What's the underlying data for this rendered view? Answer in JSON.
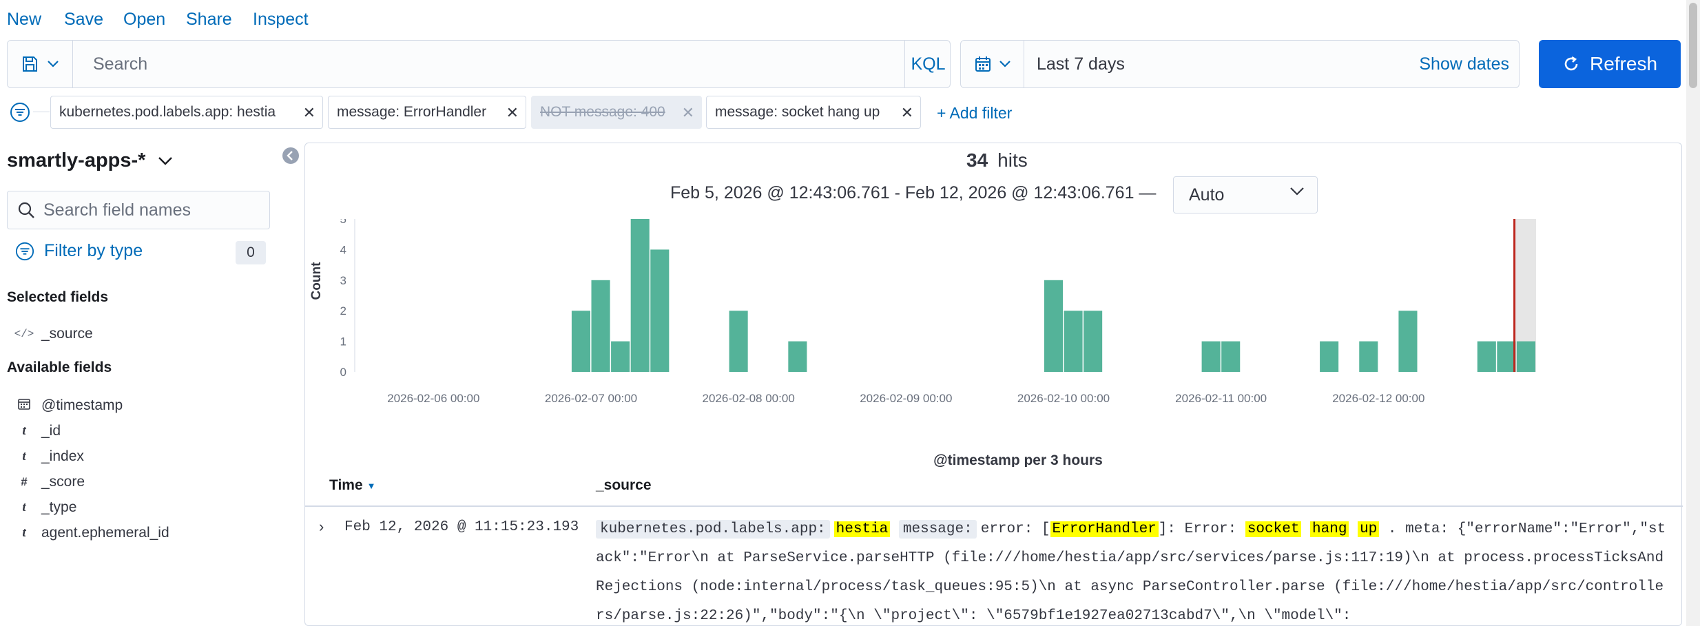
{
  "menu": [
    "New",
    "Save",
    "Open",
    "Share",
    "Inspect"
  ],
  "query": {
    "placeholder": "Search",
    "language": "KQL"
  },
  "date": {
    "range": "Last 7 days",
    "show_dates": "Show dates"
  },
  "refresh_label": "Refresh",
  "filters": [
    {
      "label": "kubernetes.pod.labels.app: hestia",
      "disabled": false
    },
    {
      "label": "message: ErrorHandler",
      "disabled": false
    },
    {
      "label": "NOT message: 400",
      "disabled": true
    },
    {
      "label": "message: socket hang up",
      "disabled": false
    }
  ],
  "add_filter": "+ Add filter",
  "sidebar": {
    "index_pattern": "smartly-apps-*",
    "search_placeholder": "Search field names",
    "filter_by_type": "Filter by type",
    "type_count": "0",
    "selected_title": "Selected fields",
    "selected_fields": [
      {
        "type": "</>",
        "name": "_source"
      }
    ],
    "available_title": "Available fields",
    "available_fields": [
      {
        "type": "calendar",
        "name": "@timestamp"
      },
      {
        "type": "t",
        "name": "_id"
      },
      {
        "type": "t",
        "name": "_index"
      },
      {
        "type": "#",
        "name": "_score"
      },
      {
        "type": "t",
        "name": "_type"
      },
      {
        "type": "t",
        "name": "agent.ephemeral_id"
      }
    ]
  },
  "hits": {
    "count": "34",
    "label": "hits"
  },
  "time_range_line": "Feb 5, 2026 @ 12:43:06.761 - Feb 12, 2026 @ 12:43:06.761 —",
  "interval": "Auto",
  "chart_data": {
    "type": "bar",
    "ylabel": "Count",
    "xlabel": "@timestamp per 3 hours",
    "ylim": [
      0,
      5
    ],
    "yticks": [
      0,
      1,
      2,
      3,
      4,
      5
    ],
    "bar_color": "#54b399",
    "x_start": "2026-02-05 12:00",
    "bucket_hours": 3,
    "x_ticks": [
      {
        "label": "2026-02-06 00:00",
        "hours": 12
      },
      {
        "label": "2026-02-07 00:00",
        "hours": 36
      },
      {
        "label": "2026-02-08 00:00",
        "hours": 60
      },
      {
        "label": "2026-02-09 00:00",
        "hours": 84
      },
      {
        "label": "2026-02-10 00:00",
        "hours": 108
      },
      {
        "label": "2026-02-11 00:00",
        "hours": 132
      },
      {
        "label": "2026-02-12 00:00",
        "hours": 156
      }
    ],
    "bars": [
      {
        "hours": 33,
        "value": 2
      },
      {
        "hours": 36,
        "value": 3
      },
      {
        "hours": 39,
        "value": 1
      },
      {
        "hours": 42,
        "value": 5
      },
      {
        "hours": 45,
        "value": 4
      },
      {
        "hours": 57,
        "value": 2
      },
      {
        "hours": 66,
        "value": 1
      },
      {
        "hours": 105,
        "value": 3
      },
      {
        "hours": 108,
        "value": 2
      },
      {
        "hours": 111,
        "value": 2
      },
      {
        "hours": 129,
        "value": 1
      },
      {
        "hours": 132,
        "value": 1
      },
      {
        "hours": 147,
        "value": 1
      },
      {
        "hours": 153,
        "value": 1
      },
      {
        "hours": 159,
        "value": 2
      },
      {
        "hours": 171,
        "value": 1
      },
      {
        "hours": 174,
        "value": 1
      },
      {
        "hours": 177,
        "value": 1
      }
    ],
    "now_marker_hours": 176.7,
    "x_end_hours": 180
  },
  "table": {
    "time_header": "Time",
    "source_header": "_source"
  },
  "document": {
    "time": "Feb 12, 2026 @ 11:15:23.193",
    "key1": "kubernetes.pod.labels.app:",
    "val1": "hestia",
    "key2": "message:",
    "msg_a": "error: [",
    "hl_errorhandler": "ErrorHandler",
    "msg_b": "]: Error: ",
    "hl_socket": "socket",
    "hl_hang": "hang",
    "hl_up": "up",
    "msg_c": ". meta: {\"errorName\":\"Error\",\"stack\":\"Error\\n at ParseService.parseHTTP (file:///home/hestia/app/src/services/parse.js:117:19)\\n at process.processTicksAndRejections (node:internal/process/task_queues:95:5)\\n at async ParseController.parse (file:///home/hestia/app/src/controllers/parse.js:22:26)\",\"body\":\"{\\n \\\"project\\\": \\\"6579bf1e1927ea02713cabd7\\\",\\n \\\"model\\\":"
  }
}
